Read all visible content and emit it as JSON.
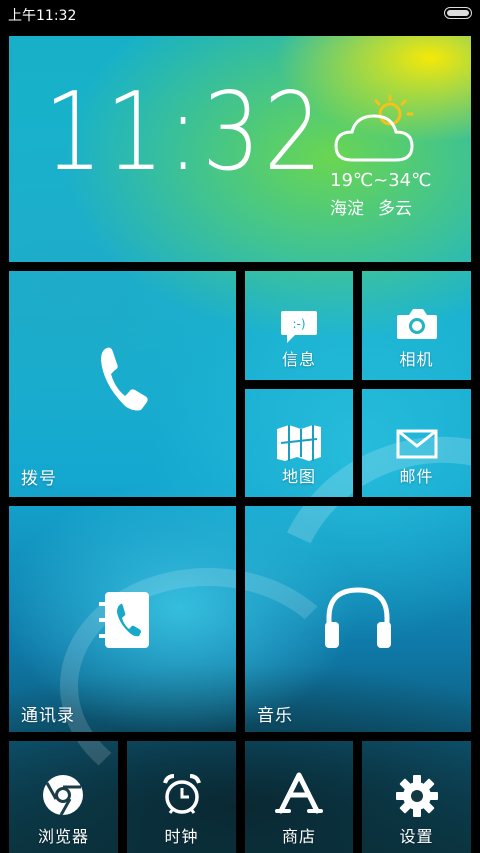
{
  "status_bar": {
    "time": "上午11:32"
  },
  "clock_widget": {
    "time": "11:32",
    "temp_range": "19℃~34℃",
    "city": "海淀",
    "condition": "多云",
    "weather_icon": "partly-cloudy-icon"
  },
  "tiles": {
    "dialer": {
      "label": "拨号",
      "icon": "phone-icon"
    },
    "messages": {
      "label": "信息",
      "icon": "chat-bubble-icon"
    },
    "camera": {
      "label": "相机",
      "icon": "camera-icon"
    },
    "maps": {
      "label": "地图",
      "icon": "map-icon"
    },
    "mail": {
      "label": "邮件",
      "icon": "envelope-icon"
    },
    "contacts": {
      "label": "通讯录",
      "icon": "contacts-book-icon"
    },
    "music": {
      "label": "音乐",
      "icon": "headphones-icon"
    },
    "browser": {
      "label": "浏览器",
      "icon": "browser-icon"
    },
    "clock": {
      "label": "时钟",
      "icon": "alarm-clock-icon"
    },
    "store": {
      "label": "商店",
      "icon": "app-store-icon"
    },
    "settings": {
      "label": "设置",
      "icon": "gear-icon"
    }
  }
}
